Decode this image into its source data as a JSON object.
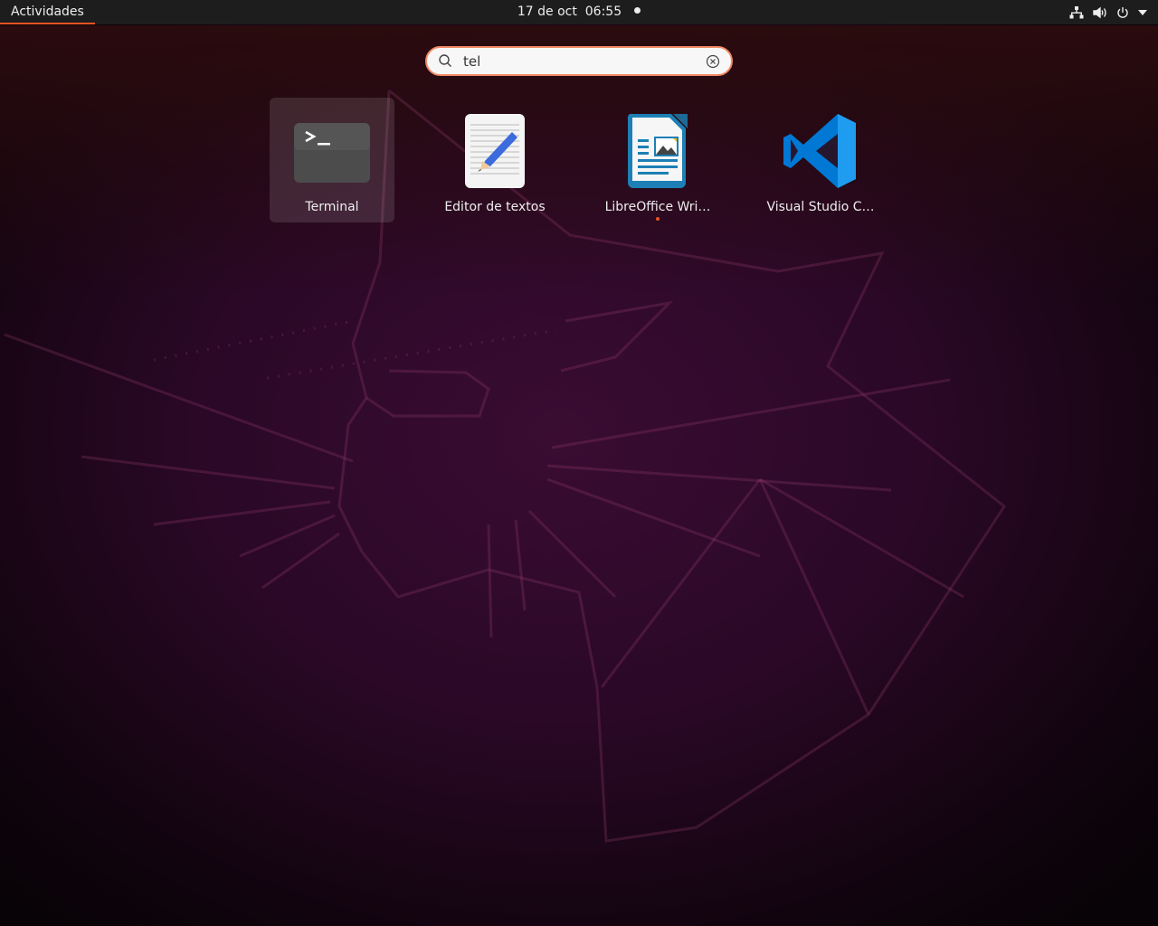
{
  "topbar": {
    "activities": "Actividades",
    "clock": "17 de oct  06:55",
    "tray": [
      "network-icon",
      "volume-icon",
      "power-icon",
      "menu-arrow-icon"
    ]
  },
  "search": {
    "value": "tel",
    "placeholder": ""
  },
  "apps": [
    {
      "label": "Terminal",
      "selected": true,
      "running": false
    },
    {
      "label": "Editor de textos",
      "selected": false,
      "running": false
    },
    {
      "label": "LibreOffice Wri…",
      "selected": false,
      "running": true
    },
    {
      "label": "Visual Studio C…",
      "selected": false,
      "running": false
    }
  ],
  "colors": {
    "accent": "#e95420",
    "topbar": "#1d1d1d",
    "search_border": "#f08a65"
  }
}
